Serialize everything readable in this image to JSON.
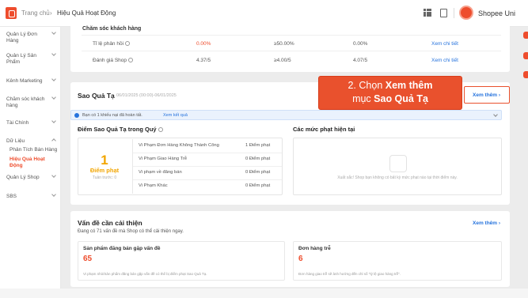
{
  "topbar": {
    "breadcrumb_home": "Trang chủ",
    "breadcrumb_sep": "›",
    "breadcrumb_current": "Hiệu Quả Hoạt Động",
    "shop_name": "Shopee Uni"
  },
  "sidebar": {
    "items": [
      {
        "label": "Quản Lý Đơn Hàng"
      },
      {
        "label": "Quản Lý Sản Phẩm"
      },
      {
        "label": "Kênh Marketing"
      },
      {
        "label": "Chăm sóc khách hàng"
      },
      {
        "label": "Tài Chính"
      },
      {
        "label": "Dữ Liệu"
      },
      {
        "label": "Phân Tích Bán Hàng"
      },
      {
        "label": "Hiệu Quả Hoạt Động"
      },
      {
        "label": "Quản Lý Shop"
      },
      {
        "label": "SBS"
      }
    ]
  },
  "customer_care": {
    "title": "Chăm sóc khách hàng",
    "rows": [
      {
        "label": "Tỉ lệ phản hồi",
        "value": "0.00%",
        "target": "≥50.00%",
        "prev": "0.00%",
        "link": "Xem chi tiết"
      },
      {
        "label": "Đánh giá Shop",
        "value": "4.37/5",
        "target": "≥4.00/5",
        "prev": "4.07/5",
        "link": "Xem chi tiết"
      }
    ]
  },
  "sao_qua_ta": {
    "title": "Sao Quả Tạ",
    "period": "06/01/2025 (00:00)-06/01/2025",
    "view_more": "Xem thêm ›",
    "info_text": "Bạn có 1 khiếu nại đã hoàn tất.",
    "info_link": "Xem kết quả",
    "points_title": "Điểm Sao Quả Tạ trong Quý",
    "score": "1",
    "score_label": "Điểm phạt",
    "score_sub": "Tuần trước: 0",
    "violations": [
      {
        "label": "Vi Phạm Đơn Hàng Không Thành Công",
        "points": "1 Điểm phạt"
      },
      {
        "label": "Vi Phạm Giao Hàng Trễ",
        "points": "0 Điểm phạt"
      },
      {
        "label": "Vi phạm về đăng bán",
        "points": "0 Điểm phạt"
      },
      {
        "label": "Vi Phạm Khác",
        "points": "0 Điểm phạt"
      }
    ],
    "penalty_title": "Các mức phạt hiện tại",
    "penalty_empty": "Xuất sắc! Shop bạn không có bất kỳ mức phạt nào tại thời điểm này."
  },
  "callout": {
    "prefix": "2. Chọn ",
    "bold1": "Xem thêm",
    "line2_prefix": "mục ",
    "bold2": "Sao Quả Tạ"
  },
  "improve": {
    "title": "Vấn đề cần cải thiện",
    "subtitle": "Đang có 71 vấn đề mà Shop có thể cải thiện ngay.",
    "view_more": "Xem thêm ›",
    "cards": [
      {
        "title": "Sản phẩm đăng bán gặp vấn đề",
        "value": "65",
        "desc": "Vi phạm nhỏ/Sản phẩm đăng bán gặp vấn đề có thể bị điểm phạt Sao Quả Tạ."
      },
      {
        "title": "Đơn hàng trễ",
        "value": "6",
        "desc": "Đơn hàng giao trễ sẽ ảnh hưởng đến chỉ số \"tỷ lệ giao hàng trễ\"."
      }
    ]
  },
  "colors": {
    "brand": "#ee4d2d",
    "link": "#2673dd",
    "score": "#f2a500"
  }
}
